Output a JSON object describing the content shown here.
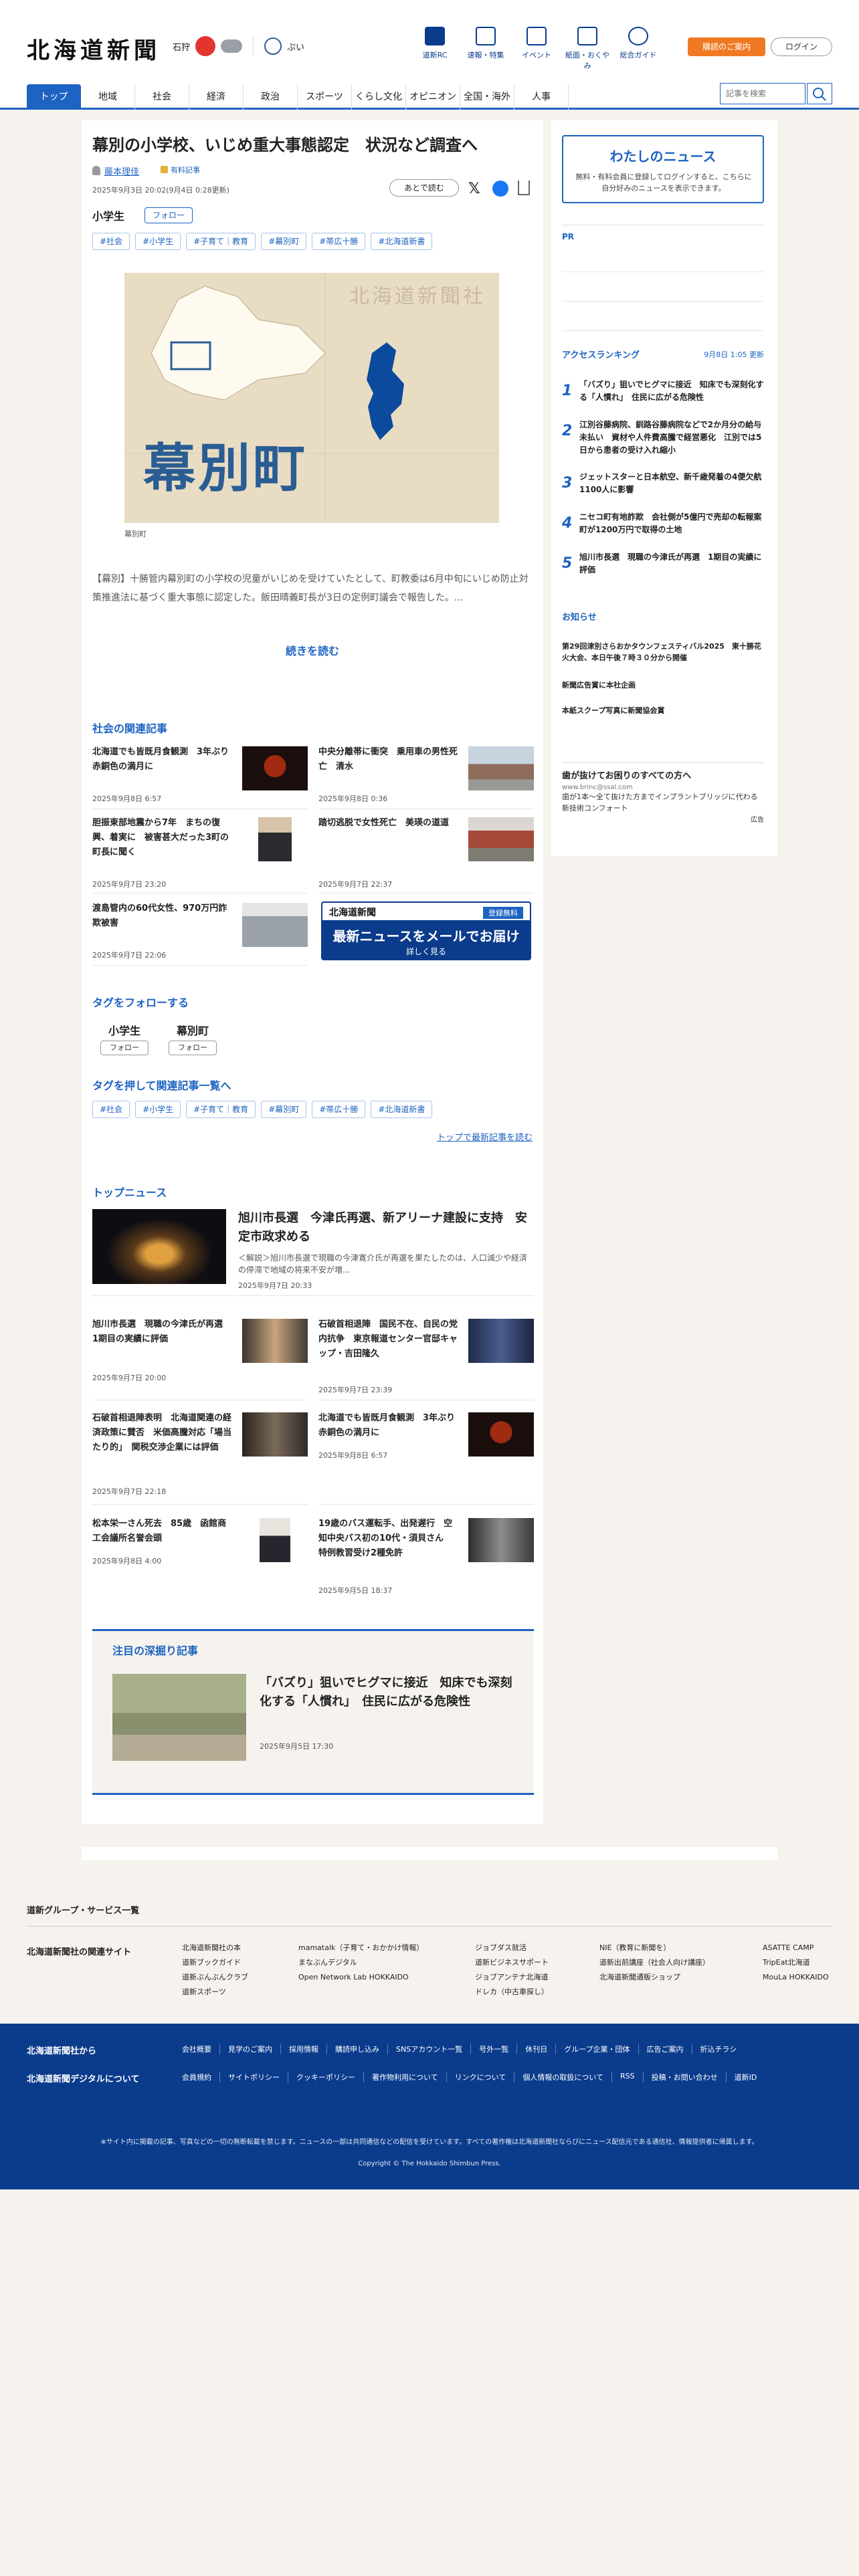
{
  "header": {
    "logo": "北海道新聞",
    "region": "石狩",
    "weather_sun": "sun-icon",
    "weather_cloud": "cloud-icon",
    "uv_label": "ぷい",
    "icons": [
      {
        "label": "道新RC",
        "icon": "book-icon"
      },
      {
        "label": "速報・特集",
        "icon": "flag-icon"
      },
      {
        "label": "イベント",
        "icon": "calendar-icon"
      },
      {
        "label": "紙面・おくやみ",
        "icon": "newspaper-icon"
      },
      {
        "label": "総合ガイド",
        "icon": "question-icon"
      }
    ],
    "subscribe_label": "購読のご案内",
    "login_label": "ログイン"
  },
  "nav": {
    "items": [
      "トップ",
      "地域",
      "社会",
      "経済",
      "政治",
      "スポーツ",
      "くらし文化",
      "オピニオン",
      "全国・海外",
      "人事"
    ],
    "search_placeholder": "記事を検索"
  },
  "article": {
    "title": "幕別の小学校、いじめ重大事態認定　状況など調査へ",
    "author": "藤本理佳",
    "member_label": "有料記事",
    "date": "2025年9月3日 20:02(9月4日 0:28更新)",
    "later_label": "あとで読む",
    "tag_name": "小学生",
    "follow_label": "フォロー",
    "tags": [
      "#社会",
      "#小学生",
      "#子育て｜教育",
      "#幕別町",
      "#帯広十勝",
      "#北海道新書"
    ],
    "map_brand": "北海道新聞社",
    "map_label": "幕別町",
    "map_caption": "幕別町",
    "lead": "【幕別】十勝管内幕別町の小学校の児童がいじめを受けていたとして、町教委は6月中旬にいじめ防止対策推進法に基づく重大事態に認定した。飯田晴義町長が3日の定例町議会で報告した。...",
    "read_more": "続きを読む"
  },
  "related": {
    "heading": "社会の関連記事",
    "items": [
      {
        "title": "北海道でも皆既月食観測　3年ぶり　赤銅色の満月に",
        "date": "2025年9月8日 6:57"
      },
      {
        "title": "中央分離帯に衝突　乗用車の男性死亡　清水",
        "date": "2025年9月8日 0:36"
      },
      {
        "title": "胆振東部地震から7年　まちの復興、着実に　被害甚大だった3町の町長に聞く",
        "date": "2025年9月7日 23:20"
      },
      {
        "title": "踏切逃脱で女性死亡　美瑛の道道",
        "date": "2025年9月7日 22:37"
      },
      {
        "title": "渡島管内の60代女性、970万円詐欺被害",
        "date": "2025年9月7日 22:06"
      }
    ],
    "mail_brand": "北海道新聞",
    "mail_free": "登録無料",
    "mail_msg": "最新ニュースをメールでお届け",
    "mail_btn": "詳しく見る"
  },
  "follow": {
    "heading": "タグをフォローする",
    "tags": [
      {
        "name": "小学生",
        "btn": "フォロー"
      },
      {
        "name": "幕別町",
        "btn": "フォロー"
      }
    ]
  },
  "push": {
    "heading": "タグを押して関連記事一覧へ",
    "tags": [
      "#社会",
      "#小学生",
      "#子育て｜教育",
      "#幕別町",
      "#帯広十勝",
      "#北海道新書"
    ],
    "link": "トップで最新記事を読む"
  },
  "top": {
    "heading": "トップニュース",
    "feature": {
      "title": "旭川市長選　今津氏再選、新アリーナ建設に支持　安定市政求める",
      "summary": "＜解説＞旭川市長選で現職の今津寛介氏が再選を果たしたのは、人口減少や経済の停滞で地域の将来不安が増...",
      "date": "2025年9月7日 20:33"
    },
    "items": [
      {
        "title": "旭川市長選　現職の今津氏が再選　1期目の実績に評価",
        "date": "2025年9月7日 20:00"
      },
      {
        "title": "石破首相退陣　国民不在、自民の党内抗争　東京報道センター官邸キャップ・吉田隆久",
        "date": "2025年9月7日 23:39"
      },
      {
        "title": "石破首相退陣表明　北海道関連の経済政策に賛否　米価高騰対応「場当たり的」　関税交渉企業には評価",
        "date": "2025年9月7日 22:18"
      },
      {
        "title": "北海道でも皆既月食観測　3年ぶり　赤銅色の満月に",
        "date": "2025年9月8日 6:57"
      },
      {
        "title": "松本栄一さん死去　85歳　函館商工会議所名誉会頭",
        "date": "2025年9月8日 4:00"
      },
      {
        "title": "19歳のバス運転手、出発遅行　空知中央バス初の10代・須貝さん　特例教習受け2種免許",
        "date": "2025年9月5日 18:37"
      }
    ]
  },
  "deep": {
    "heading": "注目の深掘り記事",
    "title": "「バズり」狙いでヒグマに接近　知床でも深刻化する「人慣れ」　住民に広がる危険性",
    "date": "2025年9月5日 17:30"
  },
  "sidebar": {
    "my_title": "わたしのニュース",
    "my_text": "無料・有料会員に登録してログインすると、こちらに自分好みのニュースを表示できます。",
    "pr_label": "PR",
    "rank_heading": "アクセスランキング",
    "rank_time": "9月8日 1:05 更新",
    "ranking": [
      "「バズり」狙いでヒグマに接近　知床でも深刻化する「人慣れ」　住民に広がる危険性",
      "江別谷藤病院、釧路谷藤病院などで2か月分の給与未払い　資材や人件費高騰で経営悪化　江別では5日から患者の受け入れ縮小",
      "ジェットスターと日本航空、新千歳発着の4便欠航　1100人に影響",
      "ニセコ町有地詐欺　会社側が5億円で売却の転報案　町が1200万円で取得の土地",
      "旭川市長選　現職の今津氏が再選　1期目の実績に評価"
    ],
    "news_heading": "お知らせ",
    "news": [
      "第29回津別さらおかタウンフェスティバル2025　東十勝花火大会、本日午後７時３０分から開催",
      "新聞広告賞に本社企画",
      "本紙スクープ写真に新聞協会賞"
    ],
    "ad_title": "歯が抜けてお困りのすべての方へ",
    "ad_url": "www.brinc@ssal.com",
    "ad_text": "歯が1本〜全て抜けた方までインプラントブリッジに代わる新技術コンフォート",
    "ad_label": "広告"
  },
  "footer": {
    "group": "道新グループ・サービス一覧",
    "related_sites": "北海道新聞社の関連サイト",
    "col1": [
      "北海道新聞社の本",
      "道新ブックガイド",
      "道新ぶんぶんクラブ",
      "道新スポーツ"
    ],
    "col2": [
      "mamatalk（子育て・おかかけ情報）",
      "まなぶんデジタル",
      "Open Network Lab HOKKAIDO"
    ],
    "col3": [
      "ジョブダス就活",
      "道新ビジネスサポート",
      "ジョブアンテナ北海道",
      "ドレカ（中古車探し）"
    ],
    "col4": [
      "NIE（教育に新聞を）",
      "道新出前講座（社会人向け講座）",
      "北海道新聞通販ショップ"
    ],
    "col5": [
      "ASATTE CAMP",
      "TripEat北海道",
      "MouLa HOKKAIDO"
    ],
    "about1": "北海道新聞社から",
    "about2": "北海道新聞デジタルについて",
    "links1": [
      "会社概要",
      "見学のご案内",
      "採用情報",
      "購読申し込み",
      "SNSアカウント一覧",
      "号外一覧",
      "休刊日",
      "グループ企業・団体",
      "広告ご案内",
      "折込チラシ"
    ],
    "links2": [
      "会員規約",
      "サイトポリシー",
      "クッキーポリシー",
      "著作物利用について",
      "リンクについて",
      "個人情報の取扱について",
      "RSS",
      "投稿・お問い合わせ",
      "道新ID"
    ],
    "notice": "※サイト内に掲載の記事、写真などの一切の無断転載を禁じます。ニュースの一部は共同通信などの配信を受けています。すべての著作権は北海道新聞社ならびにニュース配信元である通信社、情報提供者に帰属します。",
    "copyright": "Copyright © The Hokkaido Shimbun Press."
  }
}
